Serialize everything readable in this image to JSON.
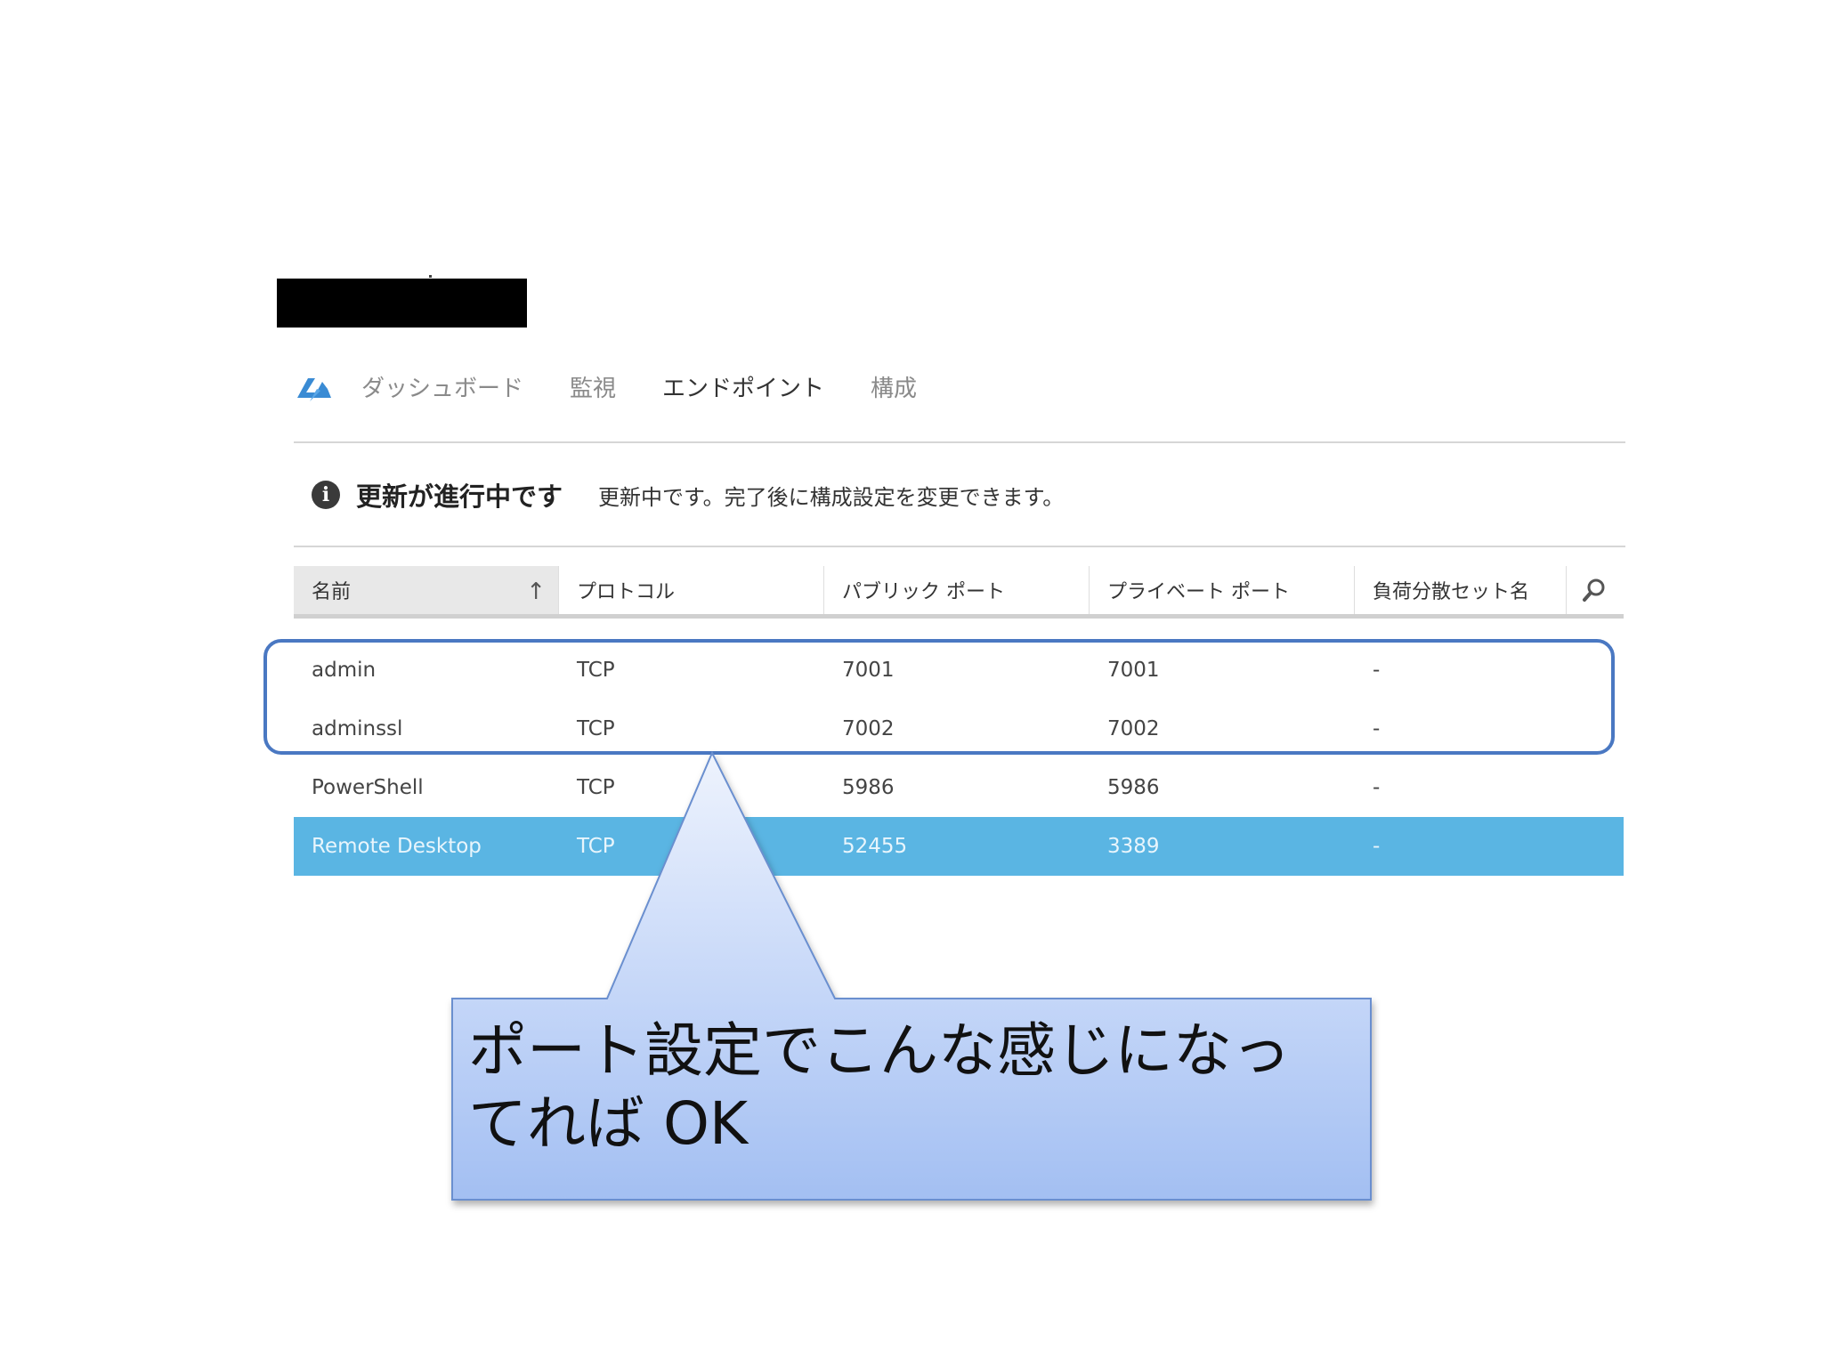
{
  "nav": {
    "logo_icon": "azure-vm-icon",
    "tabs": [
      {
        "label": "ダッシュボード",
        "active": false
      },
      {
        "label": "監視",
        "active": false
      },
      {
        "label": "エンドポイント",
        "active": true
      },
      {
        "label": "構成",
        "active": false
      }
    ]
  },
  "status": {
    "icon": "info-icon",
    "title": "更新が進行中です",
    "message": "更新中です。完了後に構成設定を変更できます。"
  },
  "table": {
    "columns": [
      "名前",
      "プロトコル",
      "パブリック ポート",
      "プライベート ポート",
      "負荷分散セット名"
    ],
    "sorted_column": "名前",
    "sort_direction": "ascending",
    "rows": [
      {
        "name": "admin",
        "protocol": "TCP",
        "public_port": "7001",
        "private_port": "7001",
        "lb_set": "-",
        "selected": false
      },
      {
        "name": "adminssl",
        "protocol": "TCP",
        "public_port": "7002",
        "private_port": "7002",
        "lb_set": "-",
        "selected": false
      },
      {
        "name": "PowerShell",
        "protocol": "TCP",
        "public_port": "5986",
        "private_port": "5986",
        "lb_set": "-",
        "selected": false
      },
      {
        "name": "Remote Desktop",
        "protocol": "TCP",
        "public_port": "52455",
        "private_port": "3389",
        "lb_set": "-",
        "selected": true
      }
    ]
  },
  "callout": {
    "line1": "ポート設定でこんな感じになっ",
    "line2": "てれば OK"
  },
  "colors": {
    "selected_row": "#5ab5e3",
    "highlight_border": "#4a78c2",
    "callout_fill_top": "#dde8fc",
    "callout_fill_bottom": "#a9c4f4",
    "callout_border": "#6b8fcf"
  }
}
